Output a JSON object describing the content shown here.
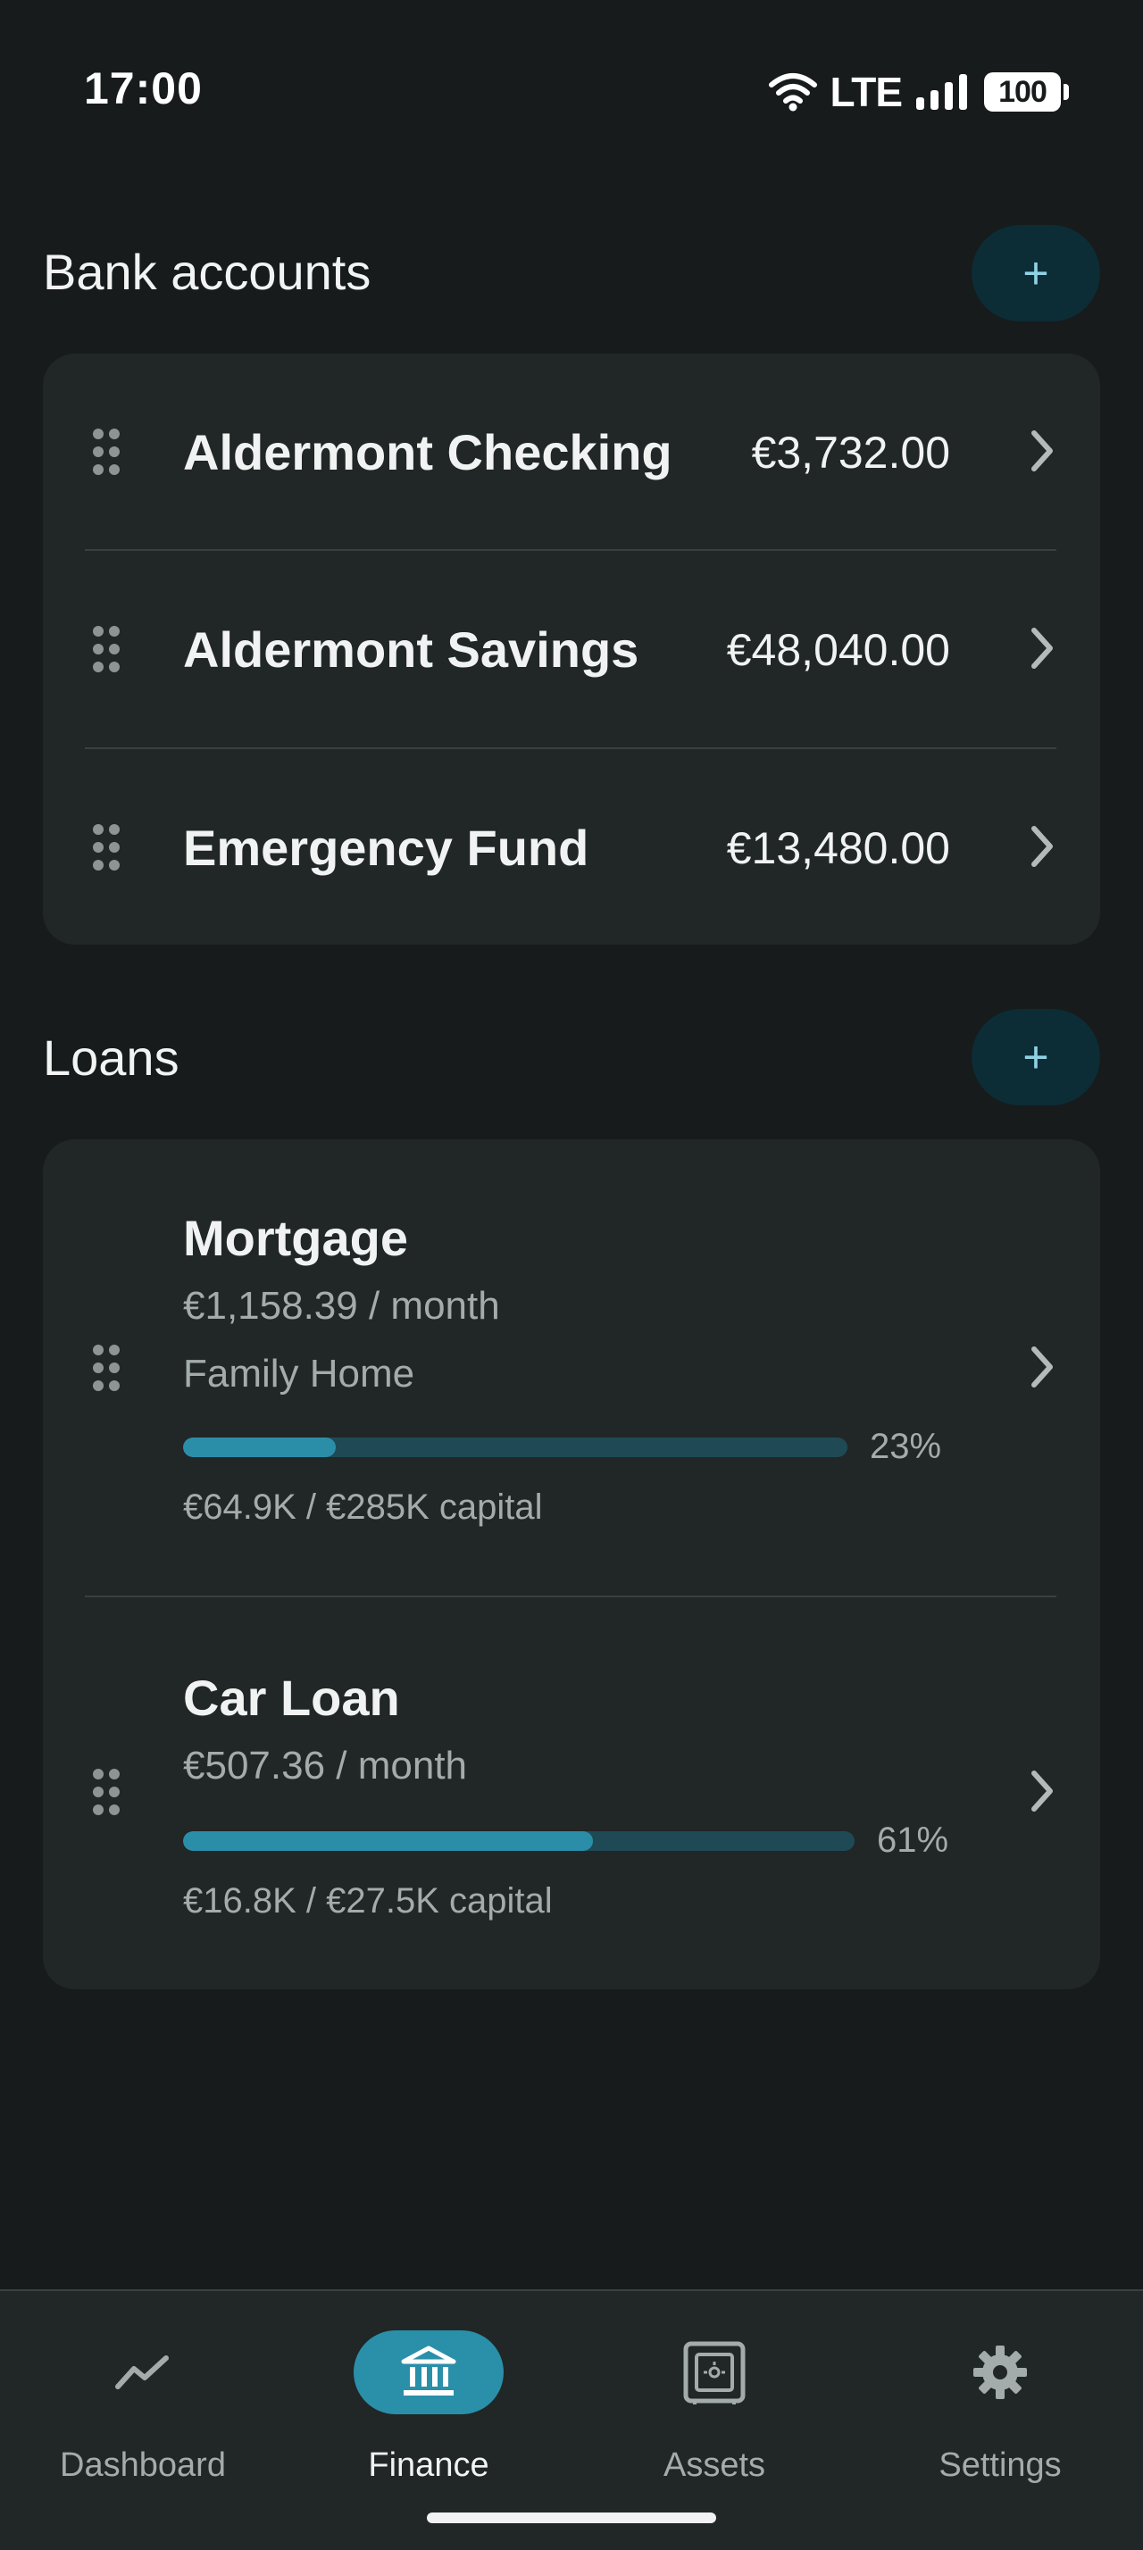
{
  "status_bar": {
    "time": "17:00",
    "network": "LTE",
    "battery": "100"
  },
  "bank_accounts": {
    "title": "Bank accounts",
    "add_label": "+",
    "items": [
      {
        "name": "Aldermont Checking",
        "balance": "€3,732.00"
      },
      {
        "name": "Aldermont Savings",
        "balance": "€48,040.00"
      },
      {
        "name": "Emergency Fund",
        "balance": "€13,480.00"
      }
    ]
  },
  "loans": {
    "title": "Loans",
    "add_label": "+",
    "items": [
      {
        "name": "Mortgage",
        "payment": "€1,158.39 / month",
        "linked_asset": "Family Home",
        "progress_percent": 23,
        "progress_label": "23%",
        "capital": "€64.9K / €285K capital"
      },
      {
        "name": "Car Loan",
        "payment": "€507.36 / month",
        "progress_percent": 61,
        "progress_label": "61%",
        "capital": "€16.8K / €27.5K capital"
      }
    ]
  },
  "bottom_nav": {
    "items": [
      {
        "label": "Dashboard",
        "icon": "trend-icon",
        "active": false
      },
      {
        "label": "Finance",
        "icon": "bank-icon",
        "active": true
      },
      {
        "label": "Assets",
        "icon": "safe-icon",
        "active": false
      },
      {
        "label": "Settings",
        "icon": "gear-icon",
        "active": false
      }
    ]
  },
  "colors": {
    "background": "#171b1b",
    "card": "#212626",
    "accent": "#2b8ea8",
    "progress_track": "#1f4a55",
    "add_button": "#0c2c36"
  }
}
